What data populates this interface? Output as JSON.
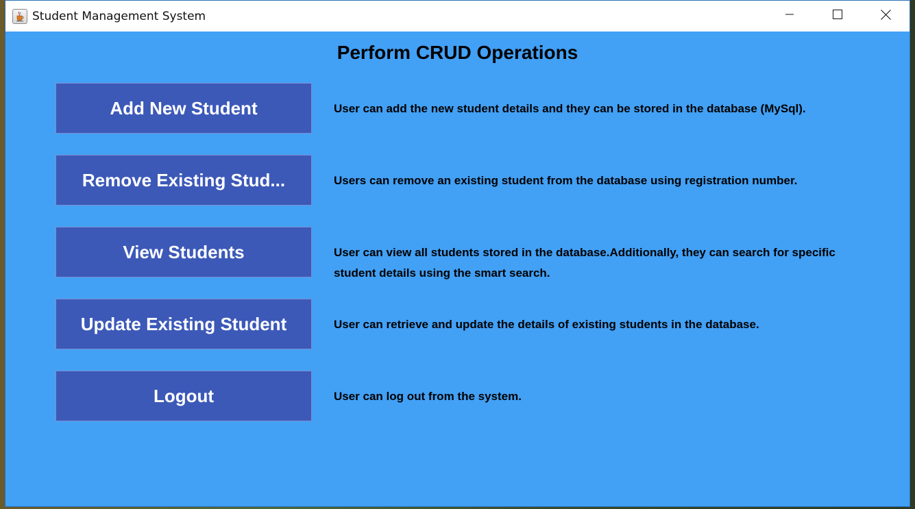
{
  "window": {
    "title": "Student Management System",
    "icon": "java-cup-icon"
  },
  "controls": {
    "minimize_icon": "minimize-icon",
    "maximize_icon": "maximize-icon",
    "close_icon": "close-icon"
  },
  "main": {
    "heading": "Perform CRUD Operations",
    "actions": [
      {
        "label": "Add New Student",
        "description": "User can add the new student details and they can be stored in the database (MySql)."
      },
      {
        "label": "Remove Existing Stud...",
        "description": "Users can remove an existing student from the database using registration number."
      },
      {
        "label": "View Students",
        "description": "User can view all students stored in the database.Additionally, they can search for specific student details using the smart search."
      },
      {
        "label": "Update Existing Student",
        "description": "User can retrieve  and update the details of existing students in the database."
      },
      {
        "label": "Logout",
        "description": "User can log out from the system."
      }
    ]
  },
  "colors": {
    "background": "#42a0f5",
    "button": "#3c59b8",
    "button_text": "#ffffff"
  }
}
